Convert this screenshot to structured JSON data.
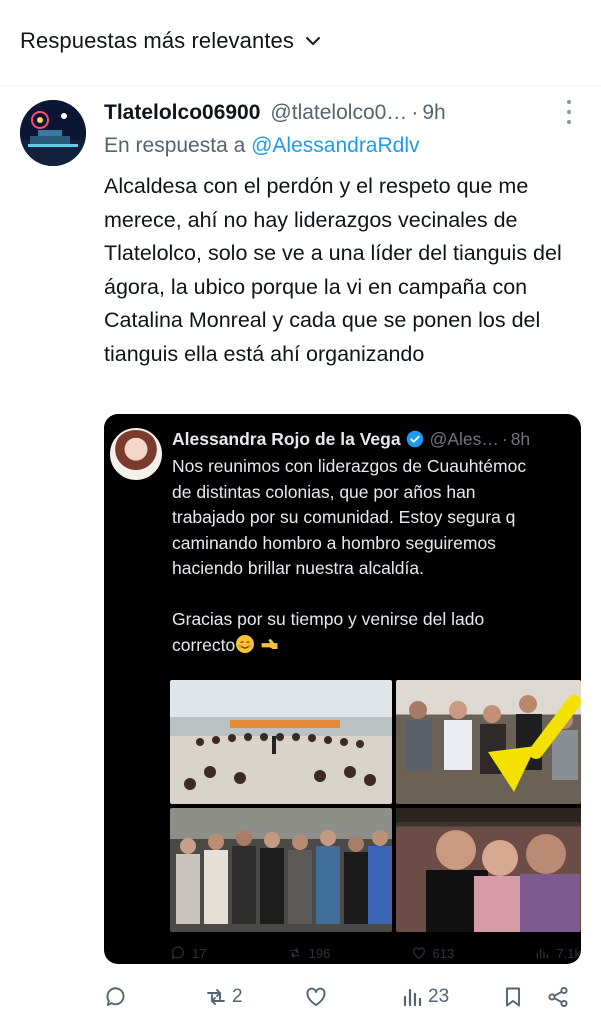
{
  "sort": {
    "label": "Respuestas más relevantes",
    "icon": "chevron-down-icon"
  },
  "tweet": {
    "display_name": "Tlatelolco06900",
    "handle": "@tlatelolco0…",
    "separator": "·",
    "time": "9h",
    "reply_prefix": "En respuesta a",
    "reply_to": "@AlessandraRdlv",
    "text": "Alcaldesa con el perdón y el respeto que me merece, ahí no hay liderazgos vecinales de Tlatelolco, solo se ve a una líder del tianguis del ágora, la ubico porque la vi en campaña con Catalina Monreal y cada que se ponen los del tianguis ella está ahí organizando",
    "actions": {
      "reply": "",
      "retweets": "2",
      "likes": "",
      "views": "23"
    }
  },
  "quote": {
    "display_name": "Alessandra Rojo de la Vega",
    "handle": "@Ales…",
    "separator": "·",
    "time": "8h",
    "text": "Nos reunimos con liderazgos de Cuauhtémoc\nde distintas colonias, que por años han\ntrabajado por su comunidad. Estoy segura q\ncaminando hombro a hombro seguiremos\nhaciendo brillar nuestra alcaldía.\n\nGracias por su tiempo y venirse del lado\ncorrecto",
    "metrics": {
      "replies": "17",
      "retweets": "196",
      "likes": "613",
      "views": "7.1k"
    }
  },
  "colors": {
    "accent": "#1d9bf0",
    "secondary_text": "#536471",
    "quote_bg": "#000000",
    "arrow": "#f5e100"
  }
}
